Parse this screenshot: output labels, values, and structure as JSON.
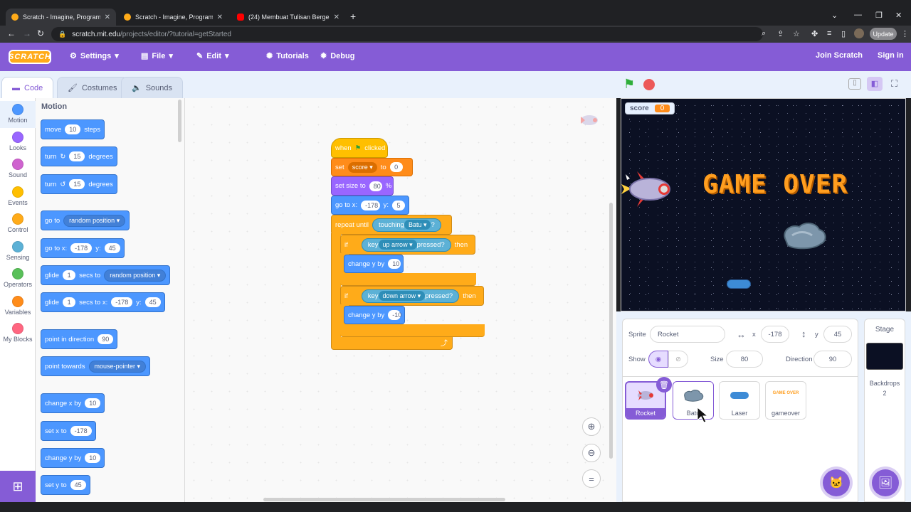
{
  "browser": {
    "tabs": [
      {
        "title": "Scratch - Imagine, Program, Sha",
        "active": true
      },
      {
        "title": "Scratch - Imagine, Program, Sha",
        "active": false
      },
      {
        "title": "(24) Membuat Tulisan Bergerak -",
        "active": false
      }
    ],
    "url_host": "scratch.mit.edu",
    "url_path": "/projects/editor/?tutorial=getStarted",
    "update_label": "Update"
  },
  "menu": {
    "logo": "SCRATCH",
    "settings": "Settings",
    "file": "File",
    "edit": "Edit",
    "tutorials": "Tutorials",
    "debug": "Debug",
    "join": "Join Scratch",
    "signin": "Sign in"
  },
  "editor_tabs": {
    "code": "Code",
    "costumes": "Costumes",
    "sounds": "Sounds"
  },
  "categories": [
    {
      "label": "Motion",
      "color": "#4c97ff"
    },
    {
      "label": "Looks",
      "color": "#9966ff"
    },
    {
      "label": "Sound",
      "color": "#cf63cf"
    },
    {
      "label": "Events",
      "color": "#ffbf00"
    },
    {
      "label": "Control",
      "color": "#ffab19"
    },
    {
      "label": "Sensing",
      "color": "#5cb1d6"
    },
    {
      "label": "Operators",
      "color": "#59c059"
    },
    {
      "label": "Variables",
      "color": "#ff8c1a"
    },
    {
      "label": "My Blocks",
      "color": "#ff6680"
    }
  ],
  "palette": {
    "title": "Motion",
    "move": {
      "a": "move",
      "v": "10",
      "b": "steps"
    },
    "turn_r": {
      "a": "turn",
      "v": "15",
      "b": "degrees"
    },
    "turn_l": {
      "a": "turn",
      "v": "15",
      "b": "degrees"
    },
    "goto": {
      "a": "go to",
      "dd": "random position"
    },
    "gotoxy": {
      "a": "go to x:",
      "x": "-178",
      "b": "y:",
      "y": "45"
    },
    "glide1": {
      "a": "glide",
      "v": "1",
      "b": "secs to",
      "dd": "random position"
    },
    "glide2": {
      "a": "glide",
      "v": "1",
      "b": "secs to x:",
      "x": "-178",
      "c": "y:",
      "y": "45"
    },
    "point": {
      "a": "point in direction",
      "v": "90"
    },
    "towards": {
      "a": "point towards",
      "dd": "mouse-pointer"
    },
    "chx": {
      "a": "change x by",
      "v": "10"
    },
    "setx": {
      "a": "set x to",
      "v": "-178"
    },
    "chy": {
      "a": "change y by",
      "v": "10"
    },
    "sety": {
      "a": "set y to",
      "v": "45"
    }
  },
  "script": {
    "when": "when",
    "clicked": "clicked",
    "set": "set",
    "setvar": "score",
    "to": "to",
    "setval": "0",
    "size": "set size to",
    "sizev": "80",
    "pct": "%",
    "goto": "go to x:",
    "gx": "-178",
    "gy_l": "y:",
    "gy": "5",
    "repeat": "repeat until",
    "touching": "touching",
    "tdd": "Batu",
    "q": "?",
    "if1": "if",
    "key1": "key",
    "k1": "up arrow",
    "pressed1": "pressed?",
    "then1": "then",
    "chy1": "change y by",
    "chy1v": "10",
    "if2": "if",
    "key2": "key",
    "k2": "down arrow",
    "pressed2": "pressed?",
    "then2": "then",
    "chy2": "change y by",
    "chy2v": "-10"
  },
  "stage": {
    "monitor_label": "score",
    "monitor_value": "0",
    "gameover": "GAME OVER"
  },
  "sprite_info": {
    "sprite_label": "Sprite",
    "name": "Rocket",
    "x_label": "x",
    "x": "-178",
    "y_label": "y",
    "y": "45",
    "show_label": "Show",
    "size_label": "Size",
    "size": "80",
    "dir_label": "Direction",
    "dir": "90"
  },
  "sprites": [
    {
      "name": "Rocket"
    },
    {
      "name": "Batu"
    },
    {
      "name": "Laser"
    },
    {
      "name": "gameover"
    }
  ],
  "stage_pane": {
    "title": "Stage",
    "backdrops_label": "Backdrops",
    "backdrops": "2"
  }
}
